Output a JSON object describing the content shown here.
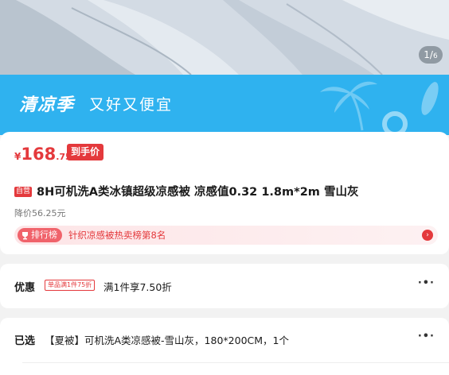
{
  "gallery": {
    "current": "1",
    "total": "6"
  },
  "banner": {
    "title": "清凉季",
    "subtitle": "又好又便宜"
  },
  "price": {
    "currency": "¥",
    "integer": "168",
    "decimal": ".75",
    "tag": "到手价"
  },
  "product": {
    "badge": "自营",
    "title": "8H可机洗A类冰镇超级凉感被 凉感值0.32 1.8m*2m 雪山灰",
    "price_drop": "降价56.25元"
  },
  "ranking": {
    "badge": "排行榜",
    "text": "针织凉感被热卖榜第8名"
  },
  "offer": {
    "label": "优惠",
    "tag": "单品满1件75折",
    "text": "满1件享7.50折"
  },
  "selected": {
    "label": "已选",
    "text": "【夏被】可机洗A类凉感被-雪山灰，180*200CM，1个"
  },
  "colors": {
    "accent": "#e4393c",
    "banner": "#2fb2ef",
    "rank_bg": "#fde5e7"
  },
  "icons": {
    "rank": "trophy-icon",
    "arrow": "chevron-right-icon",
    "more": "more-dots-icon",
    "palm": "palm-tree-icon",
    "float": "swim-ring-icon"
  }
}
